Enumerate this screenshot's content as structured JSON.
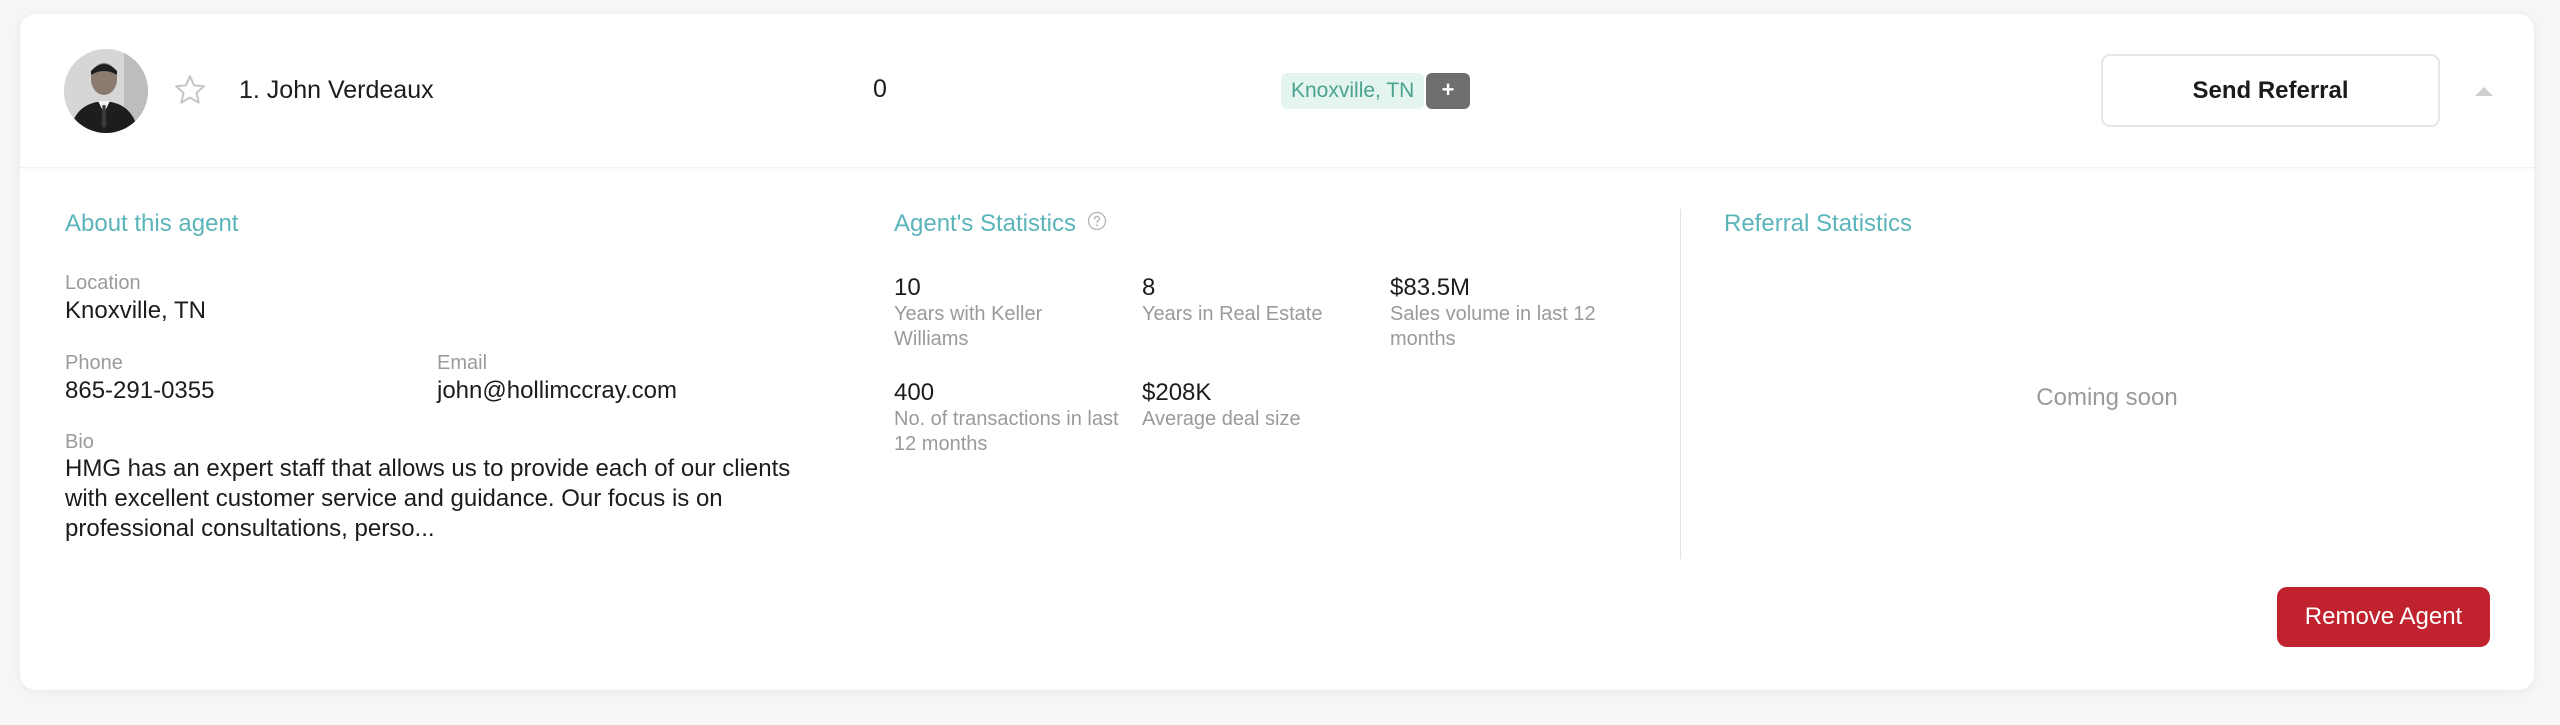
{
  "agent": {
    "name": "1. John Verdeaux",
    "count": "0",
    "location_tag": "Knoxville, TN",
    "more_tags_label": "+",
    "send_referral_label": "Send Referral"
  },
  "about": {
    "title": "About this agent",
    "location_label": "Location",
    "location_value": "Knoxville, TN",
    "phone_label": "Phone",
    "phone_value": "865-291-0355",
    "email_label": "Email",
    "email_value": "john@hollimccray.com",
    "bio_label": "Bio",
    "bio_value": "HMG has an expert staff that allows us to provide each of our clients with excellent customer service and guidance. Our focus is on professional consultations, perso..."
  },
  "stats": {
    "title": "Agent's Statistics",
    "items": [
      {
        "value": "10",
        "label": "Years with Keller Williams"
      },
      {
        "value": "8",
        "label": "Years in Real Estate"
      },
      {
        "value": "$83.5M",
        "label": "Sales volume in last 12 months"
      },
      {
        "value": "400",
        "label": "No. of transactions in last 12 months"
      },
      {
        "value": "$208K",
        "label": "Average deal size"
      }
    ]
  },
  "referral": {
    "title": "Referral Statistics",
    "placeholder": "Coming soon"
  },
  "actions": {
    "remove_label": "Remove Agent"
  },
  "colors": {
    "accent": "#5ab4b9",
    "tag_text": "#4aa38e",
    "tag_bg": "#e4f4ef",
    "danger": "#c0222e"
  },
  "icons": {
    "favorite": "star-outline-icon",
    "help": "question-circle-icon",
    "collapse": "caret-up-icon"
  }
}
